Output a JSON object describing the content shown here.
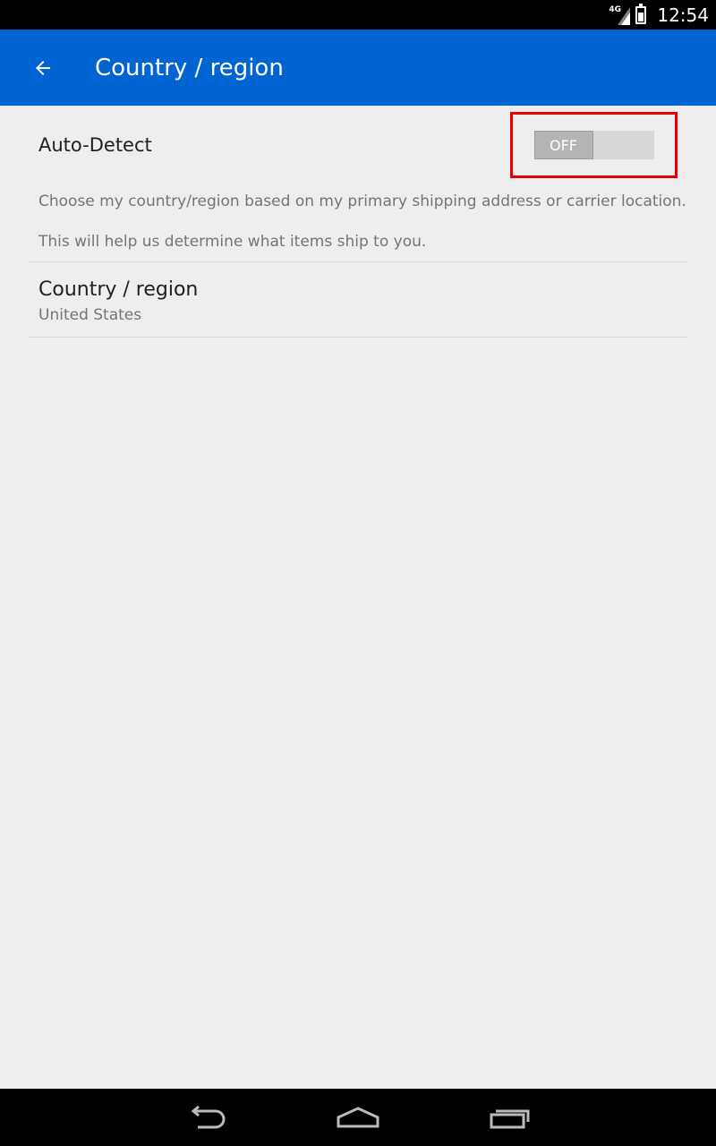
{
  "status_bar": {
    "network": "4G",
    "time": "12:54"
  },
  "app_bar": {
    "title": "Country / region",
    "back_icon": "arrow-back-icon",
    "color": "#0064d2"
  },
  "auto_detect": {
    "label": "Auto-Detect",
    "toggle_text": "OFF",
    "enabled": false,
    "description": [
      "Choose my country/region based on my primary shipping address or carrier location.",
      "This will help us determine what items ship to you."
    ]
  },
  "country": {
    "title": "Country / region",
    "value": "United States"
  },
  "nav_bar": {
    "icons": [
      "back-nav-icon",
      "home-nav-icon",
      "recents-nav-icon"
    ]
  }
}
